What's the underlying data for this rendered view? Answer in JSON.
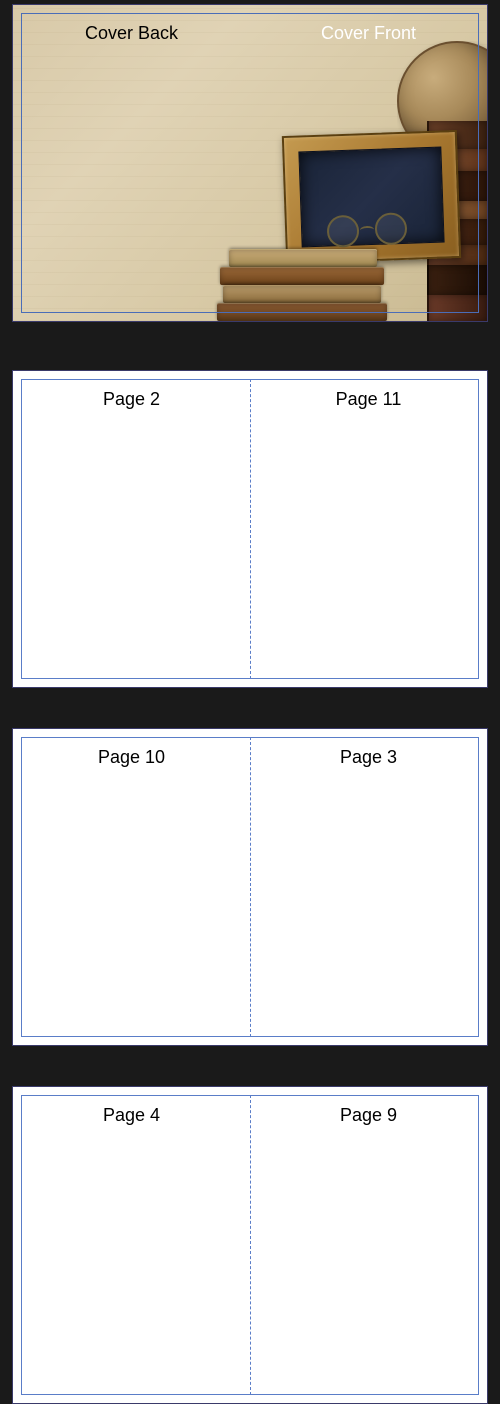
{
  "spreads": [
    {
      "left_label": "Cover Back",
      "right_label": "Cover Front",
      "is_cover": true
    },
    {
      "left_label": "Page 2",
      "right_label": "Page 11",
      "is_cover": false
    },
    {
      "left_label": "Page 10",
      "right_label": "Page 3",
      "is_cover": false
    },
    {
      "left_label": "Page 4",
      "right_label": "Page 9",
      "is_cover": false
    }
  ]
}
